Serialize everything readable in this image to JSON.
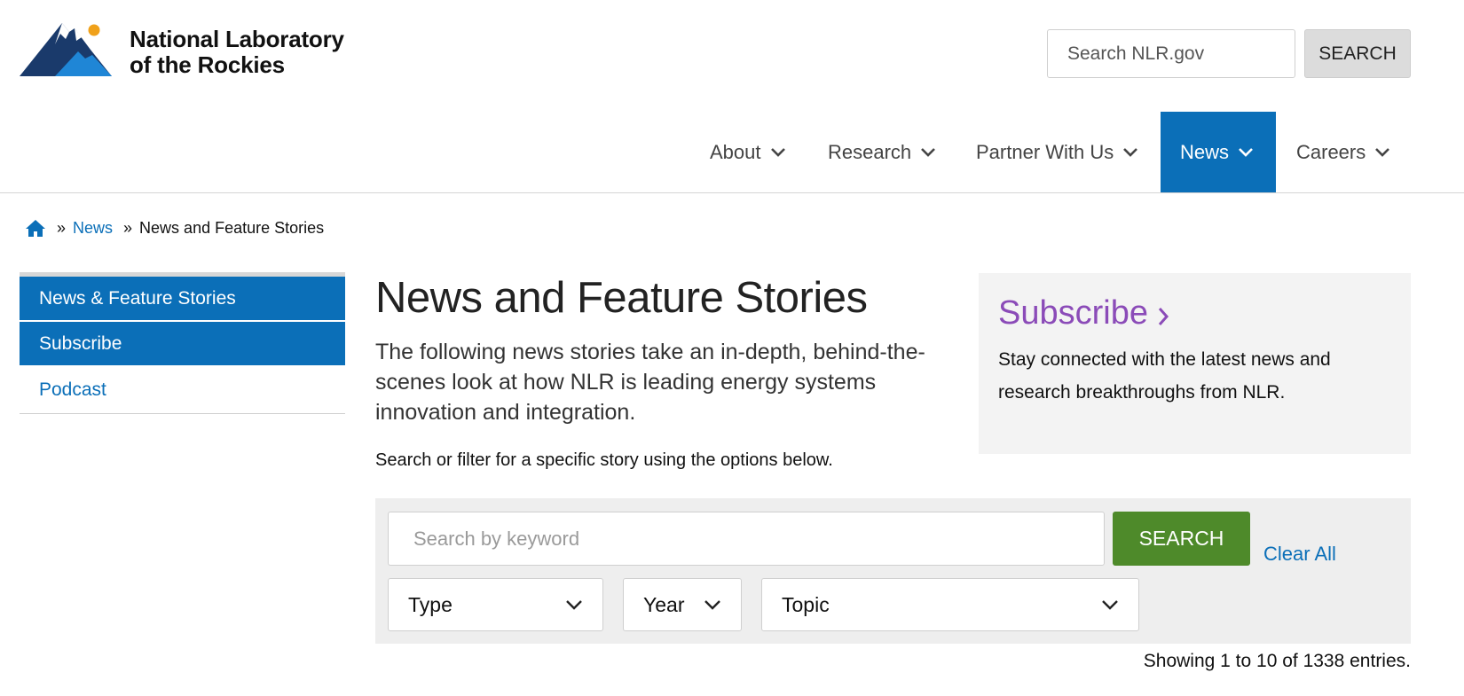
{
  "header": {
    "logo_line1": "National Laboratory",
    "logo_line2": "of the Rockies",
    "search_placeholder": "Search NLR.gov",
    "search_button": "SEARCH"
  },
  "nav": {
    "items": [
      {
        "label": "About"
      },
      {
        "label": "Research"
      },
      {
        "label": "Partner With Us"
      },
      {
        "label": "News",
        "active": true
      },
      {
        "label": "Careers"
      }
    ]
  },
  "breadcrumb": {
    "separator": "»",
    "link": "News",
    "current": "News and Feature Stories"
  },
  "sidebar": {
    "items": [
      {
        "label": "News & Feature Stories"
      },
      {
        "label": "Subscribe"
      },
      {
        "label": "Podcast"
      }
    ]
  },
  "main": {
    "title": "News and Feature Stories",
    "intro": "The following news stories take an in-depth, behind-the-scenes look at how NLR is leading energy systems innovation and integration.",
    "instructions": "Search or filter for a specific story using the options below."
  },
  "subscribe": {
    "title": "Subscribe",
    "text": "Stay connected with the latest news and research breakthroughs from NLR."
  },
  "filter": {
    "keyword_placeholder": "Search by keyword",
    "search_button": "SEARCH",
    "clear_all": "Clear All",
    "type_label": "Type",
    "year_label": "Year",
    "topic_label": "Topic",
    "showing": "Showing 1 to 10 of 1338 entries."
  },
  "colors": {
    "brand_blue": "#0b6fb8",
    "subscribe_purple": "#8b4bb8",
    "search_green": "#4e8a2a",
    "logo_navy": "#1a3a6b",
    "logo_sun": "#f0a11a"
  },
  "icons": {
    "logo": "mountain-sun-logo",
    "home": "home-icon",
    "chevron": "chevron-down-icon",
    "subscribe_arrow": "chevron-right-icon"
  }
}
